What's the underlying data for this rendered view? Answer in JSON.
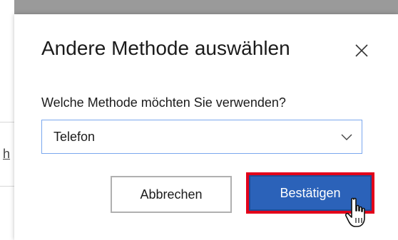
{
  "dialog": {
    "title": "Andere Methode auswählen",
    "close_icon": "close-icon",
    "question": "Welche Methode möchten Sie verwenden?",
    "method_select": {
      "value": "Telefon",
      "icon": "chevron-down-icon"
    },
    "cancel_label": "Abbrechen",
    "confirm_label": "Bestätigen"
  },
  "backdrop": {
    "partial_link_char": "h"
  },
  "colors": {
    "primary": "#2b62b9",
    "highlight": "#e2001a",
    "overlay": "#9a9a9a",
    "select_border": "#7aa7ee"
  },
  "cursor": "hand-pointer-icon"
}
